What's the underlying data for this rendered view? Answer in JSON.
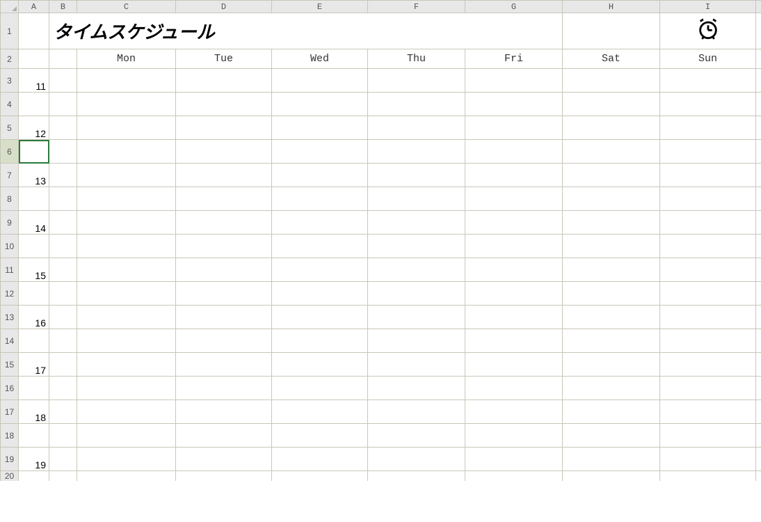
{
  "columns": [
    "A",
    "B",
    "C",
    "D",
    "E",
    "F",
    "G",
    "H",
    "I"
  ],
  "title": "タイムスケジュール",
  "days": {
    "C": "Mon",
    "D": "Tue",
    "E": "Wed",
    "F": "Thu",
    "G": "Fri",
    "H": "Sat",
    "I": "Sun"
  },
  "rowNumA": {
    "3": "11",
    "5": "12",
    "7": "13",
    "9": "14",
    "11": "15",
    "13": "16",
    "15": "17",
    "17": "18",
    "19": "19"
  },
  "rowLabels": [
    "1",
    "2",
    "3",
    "4",
    "5",
    "6",
    "7",
    "8",
    "9",
    "10",
    "11",
    "12",
    "13",
    "14",
    "15",
    "16",
    "17",
    "18",
    "19",
    "20"
  ],
  "selectedRow": "6",
  "colWidths": {
    "rowhdr": 26,
    "A": 44,
    "B": 40,
    "C": 142,
    "D": 138,
    "E": 138,
    "F": 140,
    "G": 140,
    "H": 140,
    "I": 138,
    "tail": 8
  }
}
